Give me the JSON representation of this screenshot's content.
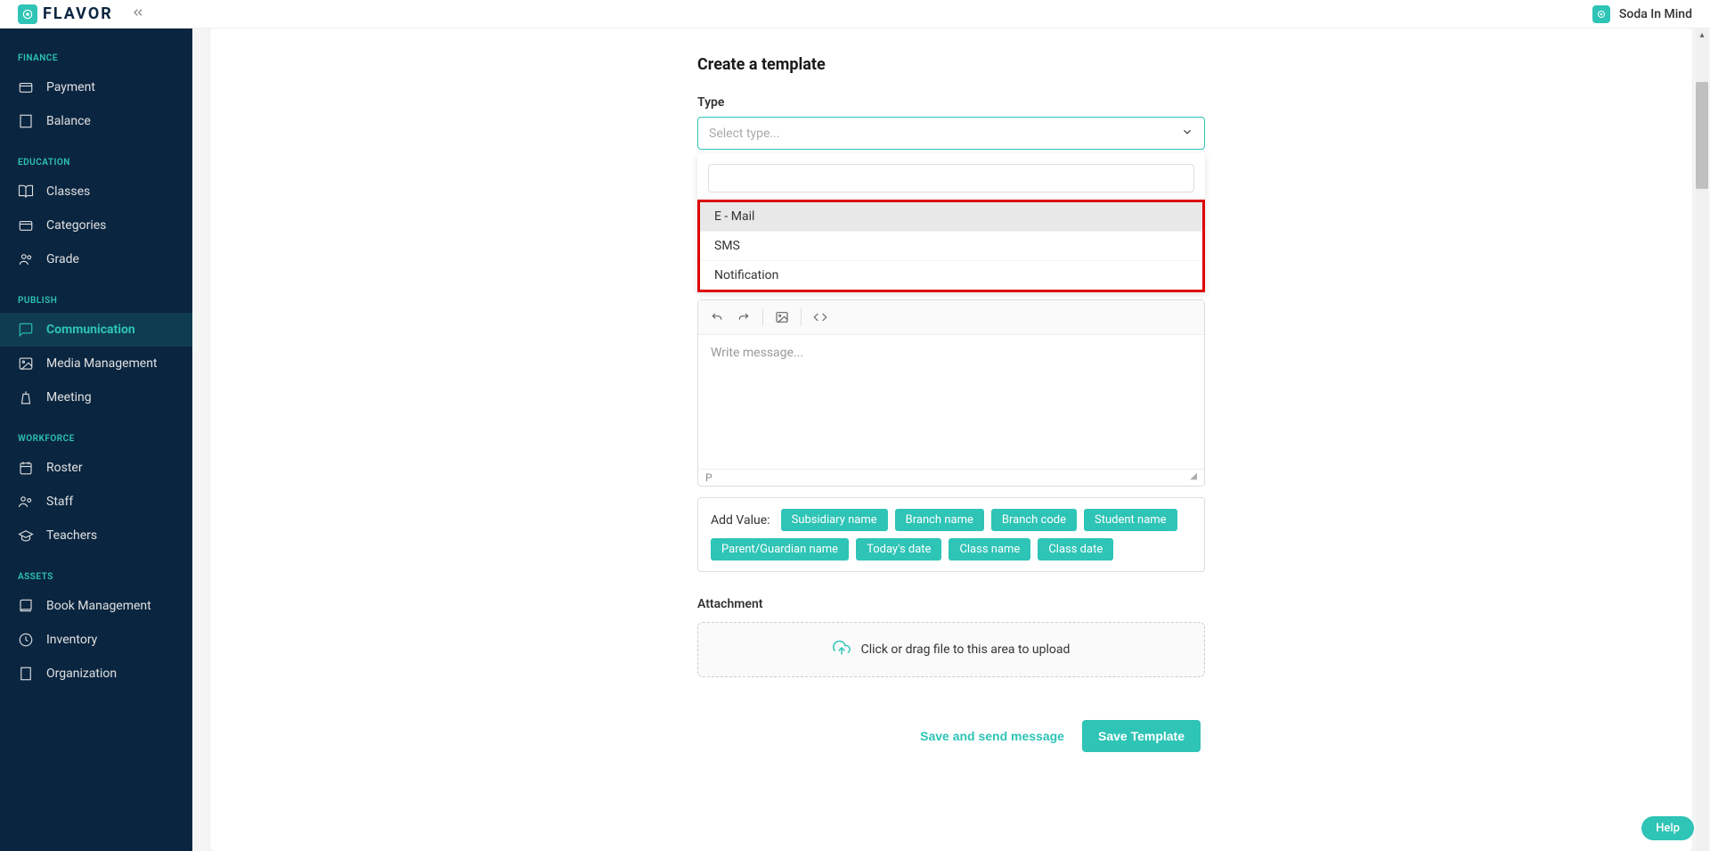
{
  "brand": {
    "logo_text": "FLAVOR",
    "account_name": "Soda In Mind"
  },
  "sidebar": {
    "sections": [
      {
        "title": "FINANCE",
        "items": [
          {
            "label": "Payment",
            "icon": "card"
          },
          {
            "label": "Balance",
            "icon": "building"
          }
        ]
      },
      {
        "title": "EDUCATION",
        "items": [
          {
            "label": "Classes",
            "icon": "book-open"
          },
          {
            "label": "Categories",
            "icon": "folder"
          },
          {
            "label": "Grade",
            "icon": "users"
          }
        ]
      },
      {
        "title": "PUBLISH",
        "items": [
          {
            "label": "Communication",
            "icon": "chat",
            "active": true
          },
          {
            "label": "Media Management",
            "icon": "image"
          },
          {
            "label": "Meeting",
            "icon": "podium"
          }
        ]
      },
      {
        "title": "WORKFORCE",
        "items": [
          {
            "label": "Roster",
            "icon": "calendar"
          },
          {
            "label": "Staff",
            "icon": "people"
          },
          {
            "label": "Teachers",
            "icon": "grad-cap"
          }
        ]
      },
      {
        "title": "ASSETS",
        "items": [
          {
            "label": "Book Management",
            "icon": "book"
          },
          {
            "label": "Inventory",
            "icon": "package"
          },
          {
            "label": "Organization",
            "icon": "office"
          }
        ]
      }
    ]
  },
  "form": {
    "title": "Create a template",
    "type_label": "Type",
    "type_placeholder": "Select type...",
    "type_options": [
      "E - Mail",
      "SMS",
      "Notification"
    ],
    "editor_placeholder": "Write message...",
    "editor_status": "P",
    "add_value_label": "Add Value:",
    "value_chips": [
      "Subsidiary name",
      "Branch name",
      "Branch code",
      "Student name",
      "Parent/Guardian name",
      "Today's date",
      "Class name",
      "Class date"
    ],
    "attachment_label": "Attachment",
    "upload_text": "Click or drag file to this area to upload",
    "save_send_label": "Save and send message",
    "save_template_label": "Save Template"
  },
  "help_label": "Help"
}
